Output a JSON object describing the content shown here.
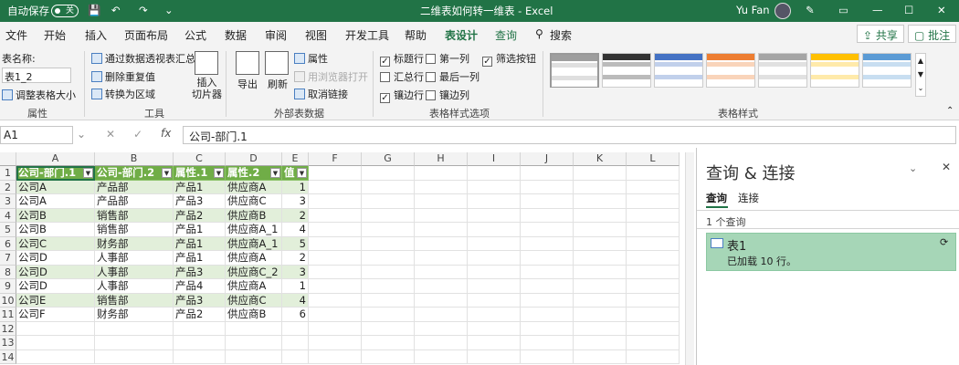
{
  "titlebar": {
    "autosave": "自动保存",
    "toggle": "关",
    "title": "二维表如何转一维表  -  Excel",
    "user": "Yu Fan"
  },
  "tabs": [
    "文件",
    "开始",
    "插入",
    "页面布局",
    "公式",
    "数据",
    "审阅",
    "视图",
    "开发工具",
    "帮助",
    "表设计",
    "查询"
  ],
  "search": "搜索",
  "share": "共享",
  "comment": "批注",
  "ribbon": {
    "table_name_label": "表名称:",
    "table_name": "表1_2",
    "resize": "调整表格大小",
    "group_properties": "属性",
    "tools": [
      "通过数据透视表汇总",
      "删除重复值",
      "转换为区域"
    ],
    "group_tools": "工具",
    "insert_slicer": "插入\n切片器",
    "export": "导出",
    "refresh": "刷新",
    "ext": [
      "属性",
      "用浏览器打开",
      "取消链接"
    ],
    "group_ext": "外部表数据",
    "opts_left": [
      {
        "label": "标题行",
        "checked": true
      },
      {
        "label": "汇总行",
        "checked": false
      },
      {
        "label": "镶边行",
        "checked": true
      }
    ],
    "opts_mid": [
      {
        "label": "第一列",
        "checked": false
      },
      {
        "label": "最后一列",
        "checked": false
      },
      {
        "label": "镶边列",
        "checked": false
      }
    ],
    "opts_right": [
      {
        "label": "筛选按钮",
        "checked": true
      }
    ],
    "group_opts": "表格样式选项",
    "group_styles": "表格样式",
    "style_colors": [
      "#9e9e9e",
      "#333333",
      "#4472c4",
      "#ed7d31",
      "#a5a5a5",
      "#ffc000",
      "#5b9bd5"
    ]
  },
  "formula": {
    "namebox": "A1",
    "content": "公司-部门.1"
  },
  "columns": [
    "A",
    "B",
    "C",
    "D",
    "E",
    "F",
    "G",
    "H",
    "I",
    "J",
    "K",
    "L"
  ],
  "rows": [
    "1",
    "2",
    "3",
    "4",
    "5",
    "6",
    "7",
    "8",
    "9",
    "10",
    "11",
    "12",
    "13",
    "14"
  ],
  "table": {
    "headers": [
      "公司-部门.1",
      "公司-部门.2",
      "属性.1",
      "属性.2",
      "值"
    ],
    "data": [
      [
        "公司A",
        "产品部",
        "产品1",
        "供应商A",
        "1"
      ],
      [
        "公司A",
        "产品部",
        "产品3",
        "供应商C",
        "3"
      ],
      [
        "公司B",
        "销售部",
        "产品2",
        "供应商B",
        "2"
      ],
      [
        "公司B",
        "销售部",
        "产品1",
        "供应商A_1",
        "4"
      ],
      [
        "公司C",
        "财务部",
        "产品1",
        "供应商A_1",
        "5"
      ],
      [
        "公司D",
        "人事部",
        "产品1",
        "供应商A",
        "2"
      ],
      [
        "公司D",
        "人事部",
        "产品3",
        "供应商C_2",
        "3"
      ],
      [
        "公司D",
        "人事部",
        "产品4",
        "供应商A",
        "1"
      ],
      [
        "公司E",
        "销售部",
        "产品3",
        "供应商C",
        "4"
      ],
      [
        "公司F",
        "财务部",
        "产品2",
        "供应商B",
        "6"
      ]
    ]
  },
  "pane": {
    "title": "查询 & 连接",
    "tab_query": "查询",
    "tab_conn": "连接",
    "count": "1 个查询",
    "query_name": "表1",
    "query_status": "已加载 10 行。"
  }
}
